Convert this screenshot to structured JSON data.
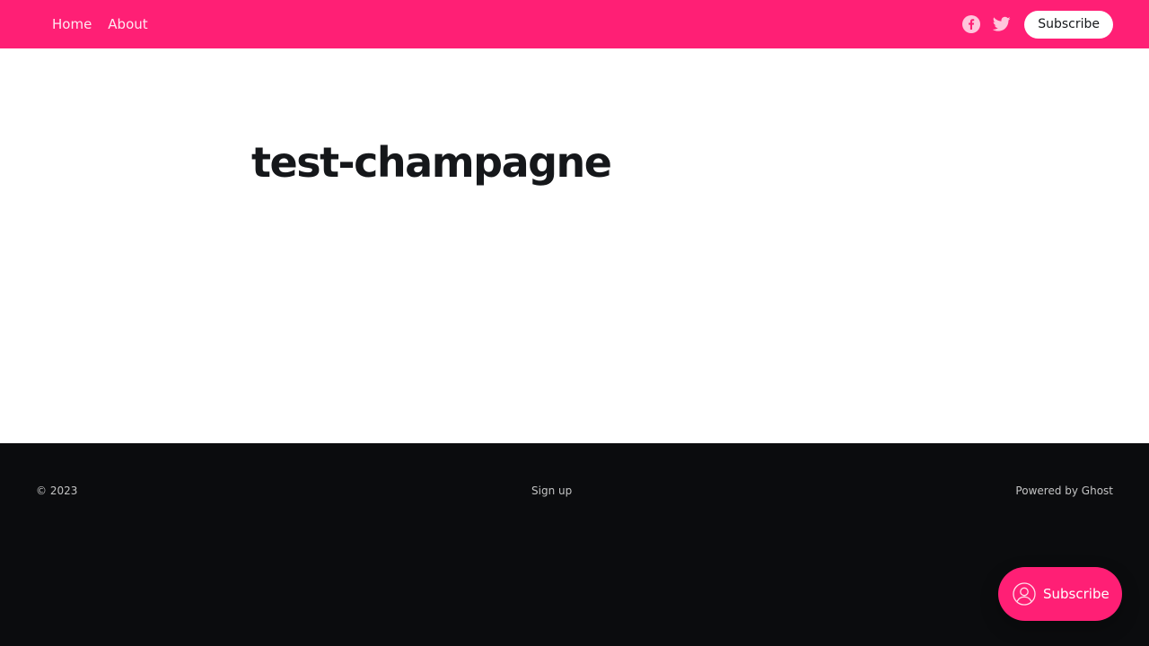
{
  "colors": {
    "accent": "#ff1f75",
    "footer_bg": "#0b0c0e",
    "title": "#15171a"
  },
  "header": {
    "nav": [
      {
        "label": "Home"
      },
      {
        "label": "About"
      }
    ],
    "social": [
      {
        "icon": "facebook-icon"
      },
      {
        "icon": "twitter-icon"
      }
    ],
    "subscribe_label": "Subscribe"
  },
  "main": {
    "title": "test-champagne"
  },
  "footer": {
    "copyright": "© 2023",
    "signup_label": "Sign up",
    "powered_prefix": "Powered by ",
    "powered_link": "Ghost"
  },
  "portal": {
    "icon": "user-circle-icon",
    "label": "Subscribe"
  }
}
